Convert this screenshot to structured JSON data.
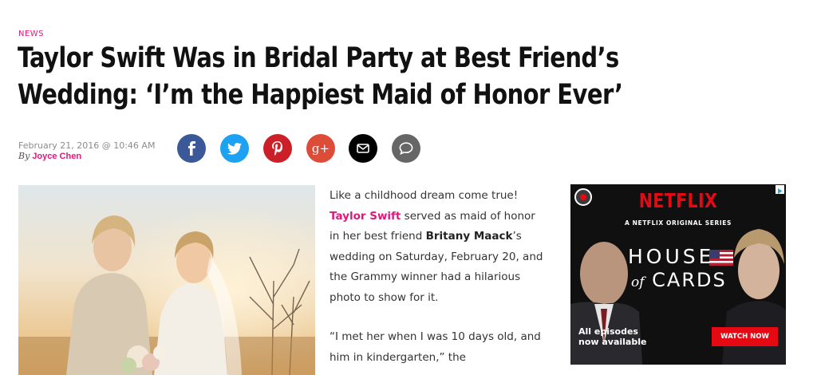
{
  "article": {
    "category": "NEWS",
    "title": "Taylor Swift Was in Bridal Party at Best Friend’s Wedding: ‘I’m the Happiest Maid of Honor Ever’",
    "date": "February 21, 2016 @ 10:46 AM",
    "byline_prefix": "By",
    "author": "Joyce Chen"
  },
  "share": [
    {
      "name": "facebook",
      "icon": "facebook-icon",
      "color": "#3b5998"
    },
    {
      "name": "twitter",
      "icon": "twitter-icon",
      "color": "#1da1f2"
    },
    {
      "name": "pinterest",
      "icon": "pinterest-icon",
      "color": "#cb2027"
    },
    {
      "name": "google-plus",
      "icon": "google-plus-icon",
      "color": "#dd4b39"
    },
    {
      "name": "email",
      "icon": "envelope-icon",
      "color": "#000000"
    },
    {
      "name": "comments",
      "icon": "comment-icon",
      "color": "#666666"
    }
  ],
  "body": {
    "p1_a": "Like a childhood dream come true!",
    "p1_link": "Taylor Swift",
    "p1_b": "served as maid of honor in her best friend",
    "p1_bold": "Britany Maack",
    "p1_c": "’s wedding on Saturday, February 20, and the Grammy winner had a hilarious photo to show for it.",
    "p2": "“I met her when I was 10 days old, and him in kindergarten,” the"
  },
  "ad": {
    "brand": "NETFLIX",
    "subtitle": "A NETFLIX ORIGINAL SERIES",
    "show_line1": "HOUSE",
    "show_of": "of",
    "show_line2": "CARDS",
    "episodes_line1": "All episodes",
    "episodes_line2": "now available",
    "button": "WATCH NOW"
  },
  "colors": {
    "accent": "#e2177b",
    "netflix_red": "#e50914"
  }
}
